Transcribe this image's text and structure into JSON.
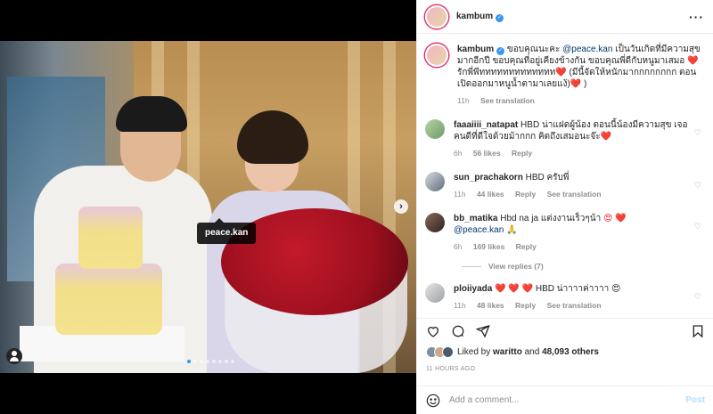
{
  "post": {
    "username": "kambum",
    "tag_label": "peace.kan",
    "time_ago": "11 HOURS AGO"
  },
  "caption": {
    "username": "kambum",
    "text_part1": "ขอบคุณนะคะ ",
    "mention": "@peace.kan",
    "text_part2": " เป็นวันเกิดที่มีความสุขมากอีกปี ขอบคุณที่อยู่เคียงข้างกัน ขอบคุณพี่ดีกับหนูมาเสมอ ",
    "heart1": "❤️",
    "text_part3": " รักพี่พีททททททททททททท",
    "heart2": "❤️",
    "text_part4": " (มีนี้จัดให้หนักมากกกกกกกก ตอนเปิดออกมาหนูน้ำตามาเลยแง้)",
    "heart3": "❤️",
    "text_part5": " )",
    "time": "11h",
    "translate": "See translation"
  },
  "comments": [
    {
      "username": "faaaiiii_natapat",
      "text": "HBD น่าแฝดผู้น้อง ตอนนี้น้องมีความสุข เจอคนดีที่ดีใจด้วยม้ากกก คิดถึงเสมอนะจ๊ะ",
      "emoji": "❤️",
      "time": "6h",
      "likes": "56 likes",
      "reply": "Reply",
      "translate": ""
    },
    {
      "username": "sun_prachakorn",
      "text": "HBD ครับพี่",
      "emoji": "",
      "time": "11h",
      "likes": "44 likes",
      "reply": "Reply",
      "translate": "See translation"
    },
    {
      "username": "bb_matika",
      "text": "Hbd na ja แต่งงานเร็วๆน้า",
      "emoji": "😍 ❤️",
      "mention": "@peace.kan",
      "mention_emoji": "🙏",
      "time": "6h",
      "likes": "169 likes",
      "reply": "Reply",
      "translate": "",
      "view_replies": "View replies (7)"
    },
    {
      "username": "ploiiyada",
      "pre_emoji": "❤️ ❤️ ❤️",
      "text": " HBD น่าาาาค่าาาา",
      "emoji": "😍",
      "time": "11h",
      "likes": "48 likes",
      "reply": "Reply",
      "translate": "See translation"
    }
  ],
  "likes": {
    "prefix": "Liked by",
    "user": "waritto",
    "middle": "and",
    "count": "48,093 others"
  },
  "add_comment": {
    "placeholder": "Add a comment...",
    "post_label": "Post"
  },
  "icons": {
    "heart": "heart-icon",
    "comment": "comment-icon",
    "share": "share-icon",
    "bookmark": "bookmark-icon",
    "emoji": "emoji-icon",
    "more": "more-options-icon",
    "next": "chevron-right-icon"
  },
  "colors": {
    "link": "#00376b",
    "verified": "#3897f0",
    "muted": "#8e8e8e",
    "post_disabled": "#b2dffc"
  }
}
